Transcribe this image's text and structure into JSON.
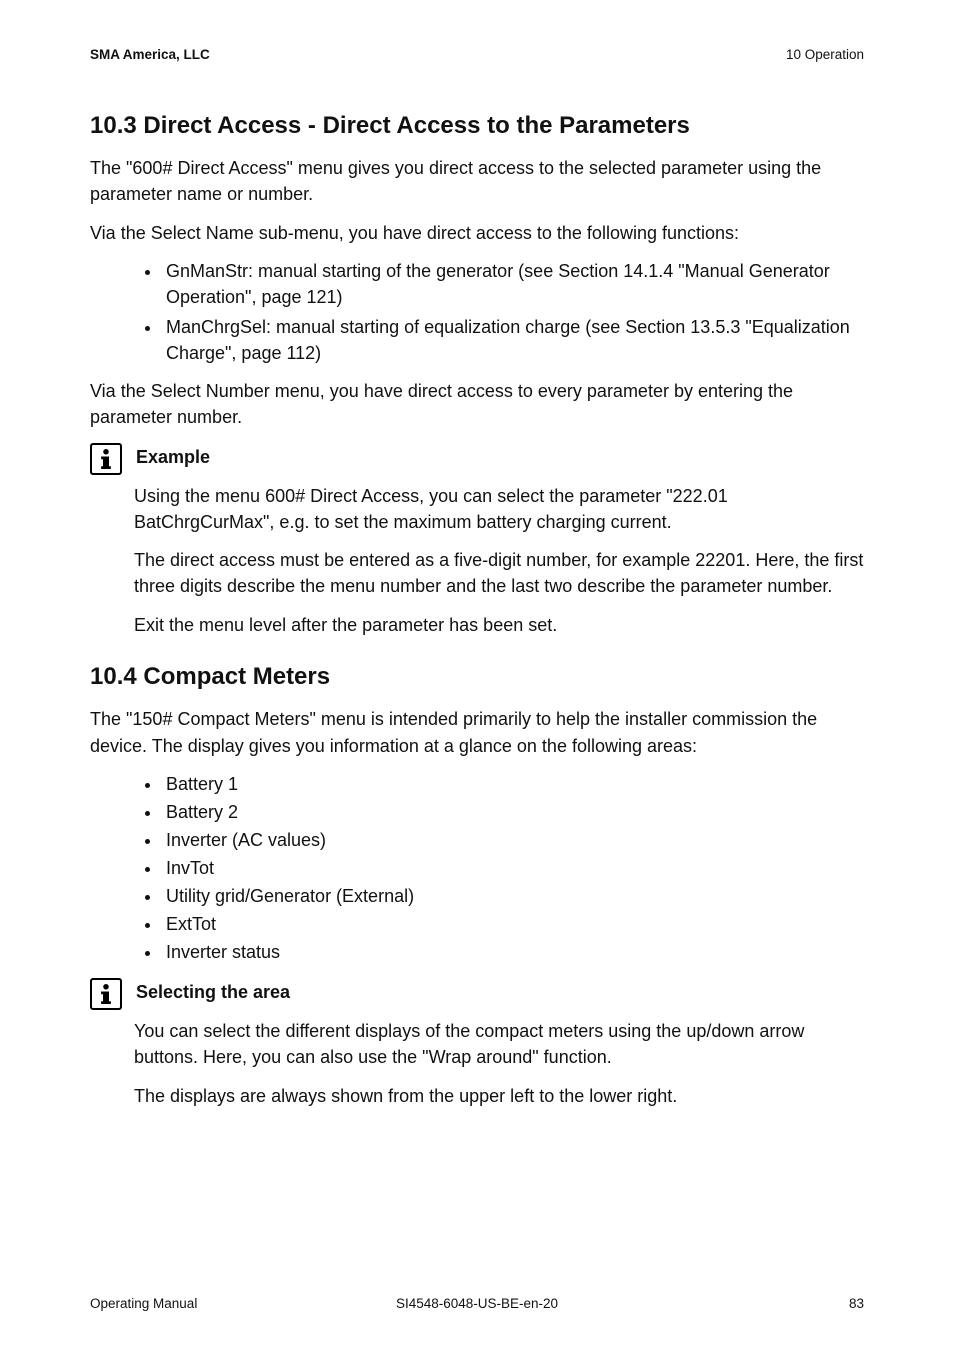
{
  "header": {
    "company": "SMA America, LLC",
    "chapter": "10  Operation"
  },
  "section1": {
    "heading": "10.3 Direct Access - Direct Access to the Parameters",
    "p1": "The \"600# Direct Access\" menu gives you direct access to the selected parameter using the parameter name or number.",
    "p2": "Via the Select Name sub-menu, you have direct access to the following functions:",
    "bullets": [
      "GnManStr: manual starting of the generator (see Section 14.1.4 \"Manual Generator Operation\", page 121)",
      "ManChrgSel: manual starting of equalization charge (see Section 13.5.3 \"Equalization Charge\", page 112)"
    ],
    "p3": "Via the Select Number menu, you have direct access to every parameter by entering the parameter number.",
    "note": {
      "title": "Example",
      "p1": "Using the menu 600# Direct Access, you can select the parameter \"222.01 BatChrgCurMax\", e.g. to set the maximum battery charging current.",
      "p2": "The direct access must be entered as a five-digit number, for example 22201. Here, the first three digits describe the menu number and the last two describe the parameter number.",
      "p3": "Exit the menu level after the parameter has been set."
    }
  },
  "section2": {
    "heading": "10.4 Compact Meters",
    "p1": "The \"150# Compact Meters\" menu is intended primarily to help the installer commission the device. The display gives you information at a glance on the following areas:",
    "bullets": [
      "Battery 1",
      "Battery 2",
      "Inverter (AC values)",
      "InvTot",
      "Utility grid/Generator (External)",
      "ExtTot",
      "Inverter status"
    ],
    "note": {
      "title": "Selecting the area",
      "p1": "You can select the different displays of the compact meters using the up/down arrow buttons. Here, you can also use the \"Wrap around\" function.",
      "p2": "The displays are always shown from the upper left to the lower right."
    }
  },
  "footer": {
    "left": "Operating Manual",
    "center": "SI4548-6048-US-BE-en-20",
    "right": "83"
  }
}
